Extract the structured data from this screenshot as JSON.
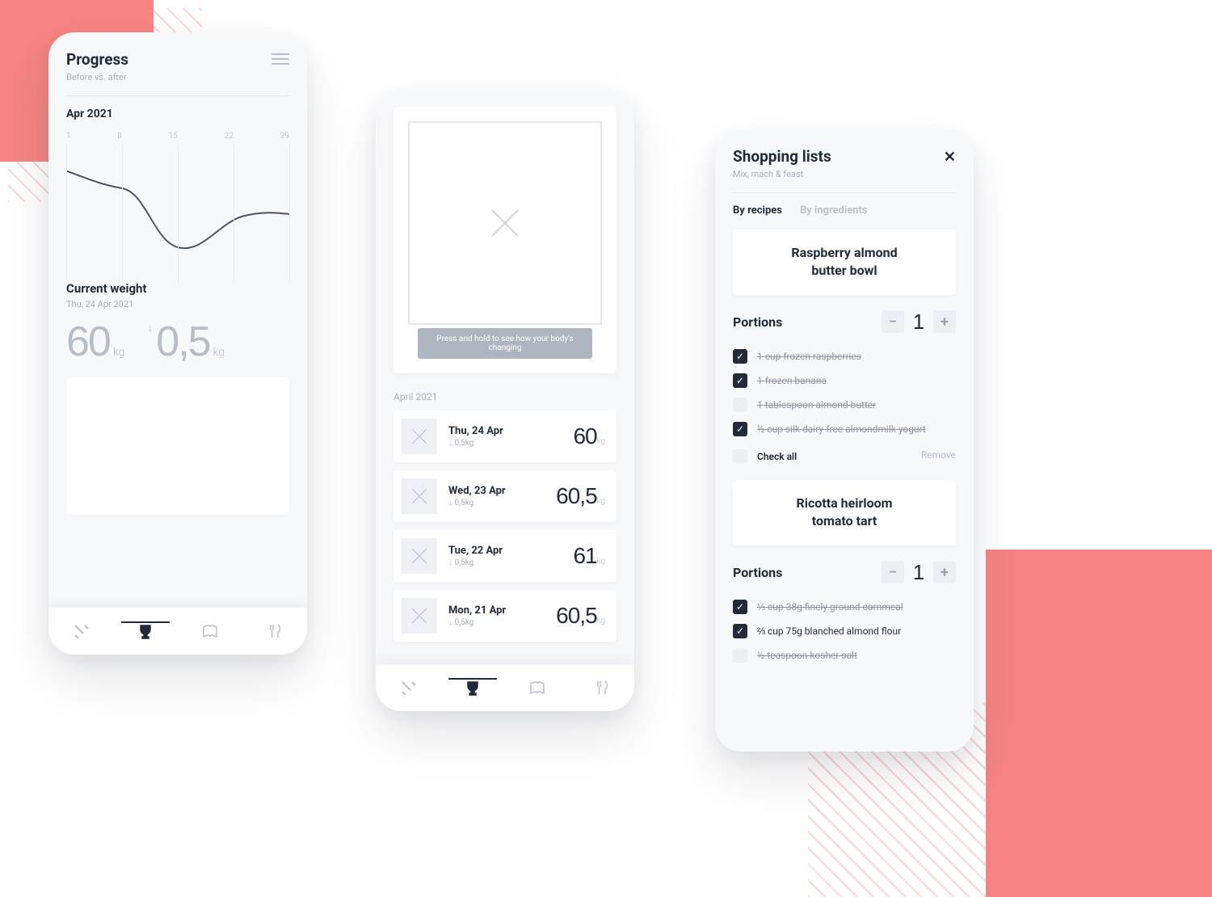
{
  "progress": {
    "title": "Progress",
    "subtitle": "Before vs. after",
    "month": "Apr 2021",
    "ticks": [
      "1",
      "8",
      "15",
      "22",
      "29"
    ],
    "current_label": "Current weight",
    "current_date": "Thu, 24 Apr 2021",
    "current_value": "60",
    "current_unit": "kg",
    "delta_value": "0,5",
    "delta_unit": "kg"
  },
  "history": {
    "hero_tip": "Press and hold to see how your body's changing",
    "month": "April 2021",
    "entries": [
      {
        "date": "Thu, 24 Apr",
        "delta": "↓ 0,5kg",
        "weight": "60",
        "unit": "kg"
      },
      {
        "date": "Wed, 23 Apr",
        "delta": "↓ 0,5kg",
        "weight": "60,5",
        "unit": "kg"
      },
      {
        "date": "Tue, 22 Apr",
        "delta": "↓ 0,5kg",
        "weight": "61",
        "unit": "kg"
      },
      {
        "date": "Mon, 21 Apr",
        "delta": "↓ 0,5kg",
        "weight": "60,5",
        "unit": "kg"
      }
    ]
  },
  "shopping": {
    "title": "Shopping lists",
    "subtitle": "Mix, mach & feast",
    "tabs": {
      "byRecipes": "By recipes",
      "byIngredients": "By ingredients"
    },
    "portions_label": "Portions",
    "recipes": [
      {
        "name": "Raspberry almond butter bowl",
        "portions": "1",
        "ingredients": [
          {
            "checked": true,
            "text": "1 cup frozen raspberries"
          },
          {
            "checked": true,
            "text": "1 frozen banana"
          },
          {
            "checked": false,
            "text": "1 tablespoon almond butter"
          },
          {
            "checked": true,
            "text": "½ cup silk dairy-free almondmilk yogurt"
          }
        ],
        "check_all": "Check all",
        "remove": "Remove"
      },
      {
        "name": "Ricotta heirloom tomato tart",
        "portions": "1",
        "ingredients": [
          {
            "checked": true,
            "text": "⅓ cup 38g finely ground cornmeal"
          },
          {
            "checked": true,
            "text": "⅔ cup 75g blanched almond flour",
            "normal": true
          },
          {
            "checked": false,
            "text": "½ teaspoon kosher salt"
          }
        ]
      }
    ]
  },
  "chart_data": {
    "type": "line",
    "title": "Progress",
    "xlabel": "Apr 2021",
    "categories": [
      1,
      8,
      15,
      22,
      29
    ],
    "values": [
      62.0,
      61.5,
      60.0,
      60.5,
      61.0
    ],
    "ylim": [
      59,
      63
    ]
  }
}
